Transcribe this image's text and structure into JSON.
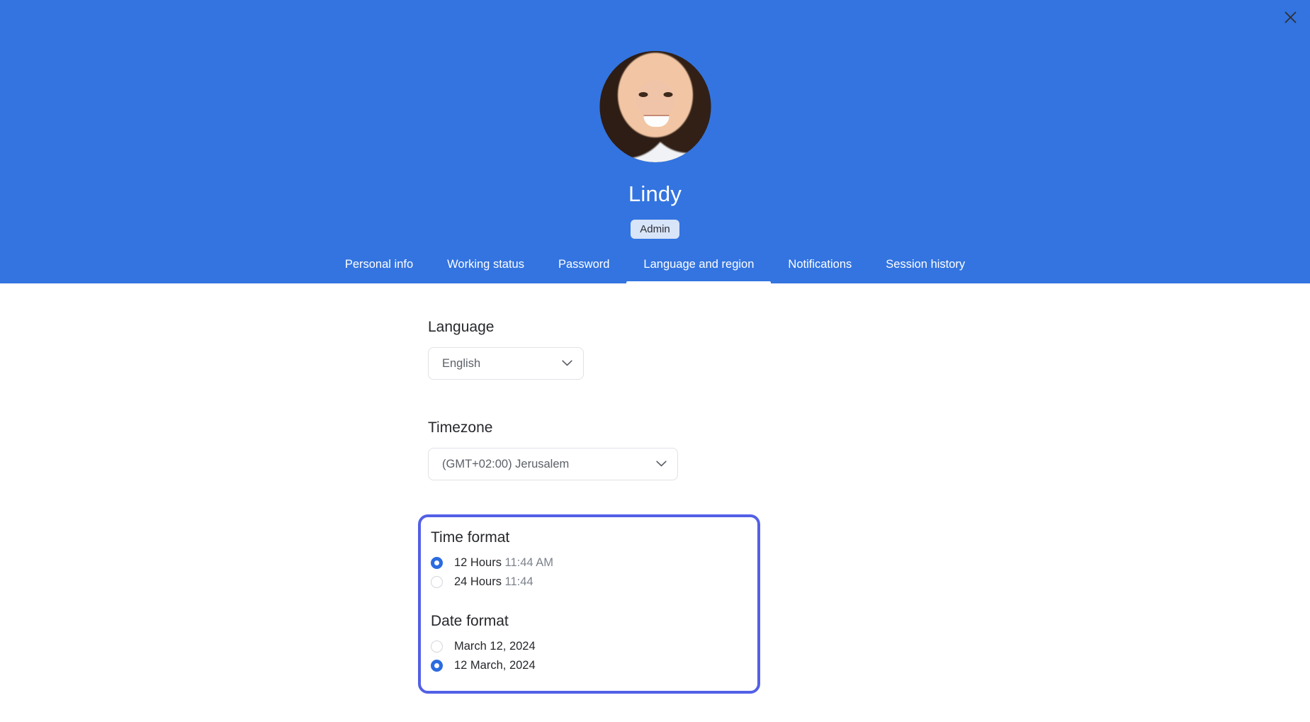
{
  "colors": {
    "header_blue": "#3374E0",
    "highlight_border": "#5360E6",
    "radio_selected": "#2B6CE0",
    "badge_bg": "#D8E4F7"
  },
  "header": {
    "close_icon": "close-icon",
    "avatar_alt": "user-avatar-photo",
    "name": "Lindy",
    "role_badge": "Admin",
    "tabs": [
      {
        "label": "Personal info",
        "active": false
      },
      {
        "label": "Working status",
        "active": false
      },
      {
        "label": "Password",
        "active": false
      },
      {
        "label": "Language and region",
        "active": true
      },
      {
        "label": "Notifications",
        "active": false
      },
      {
        "label": "Session history",
        "active": false
      }
    ]
  },
  "main": {
    "language": {
      "label": "Language",
      "selected": "English",
      "chevron_icon": "chevron-down-icon"
    },
    "timezone": {
      "label": "Timezone",
      "selected": "(GMT+02:00) Jerusalem",
      "chevron_icon": "chevron-down-icon"
    },
    "time_format": {
      "heading": "Time format",
      "options": [
        {
          "label": "12 Hours",
          "sample": "11:44 AM",
          "selected": true
        },
        {
          "label": "24 Hours",
          "sample": "11:44",
          "selected": false
        }
      ]
    },
    "date_format": {
      "heading": "Date format",
      "options": [
        {
          "label": "March 12, 2024",
          "sample": "",
          "selected": false
        },
        {
          "label": "12 March, 2024",
          "sample": "",
          "selected": true
        }
      ]
    }
  }
}
